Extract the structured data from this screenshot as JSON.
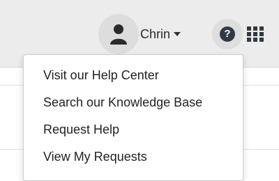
{
  "header": {
    "user": {
      "name": "Chrin",
      "avatar_icon": "user-icon",
      "dropdown_icon": "caret-down-icon"
    },
    "help_icon": {
      "name": "question-circle-icon",
      "glyph": "?"
    },
    "apps_icon": "grid-icon"
  },
  "dropdown": {
    "items": [
      {
        "label": "Visit our Help Center"
      },
      {
        "label": "Search our Knowledge Base"
      },
      {
        "label": "Request Help"
      },
      {
        "label": "View My Requests"
      }
    ]
  },
  "colors": {
    "header_bg": "#ececec",
    "help_icon_bg": "#2f3a45",
    "text": "#222222"
  }
}
